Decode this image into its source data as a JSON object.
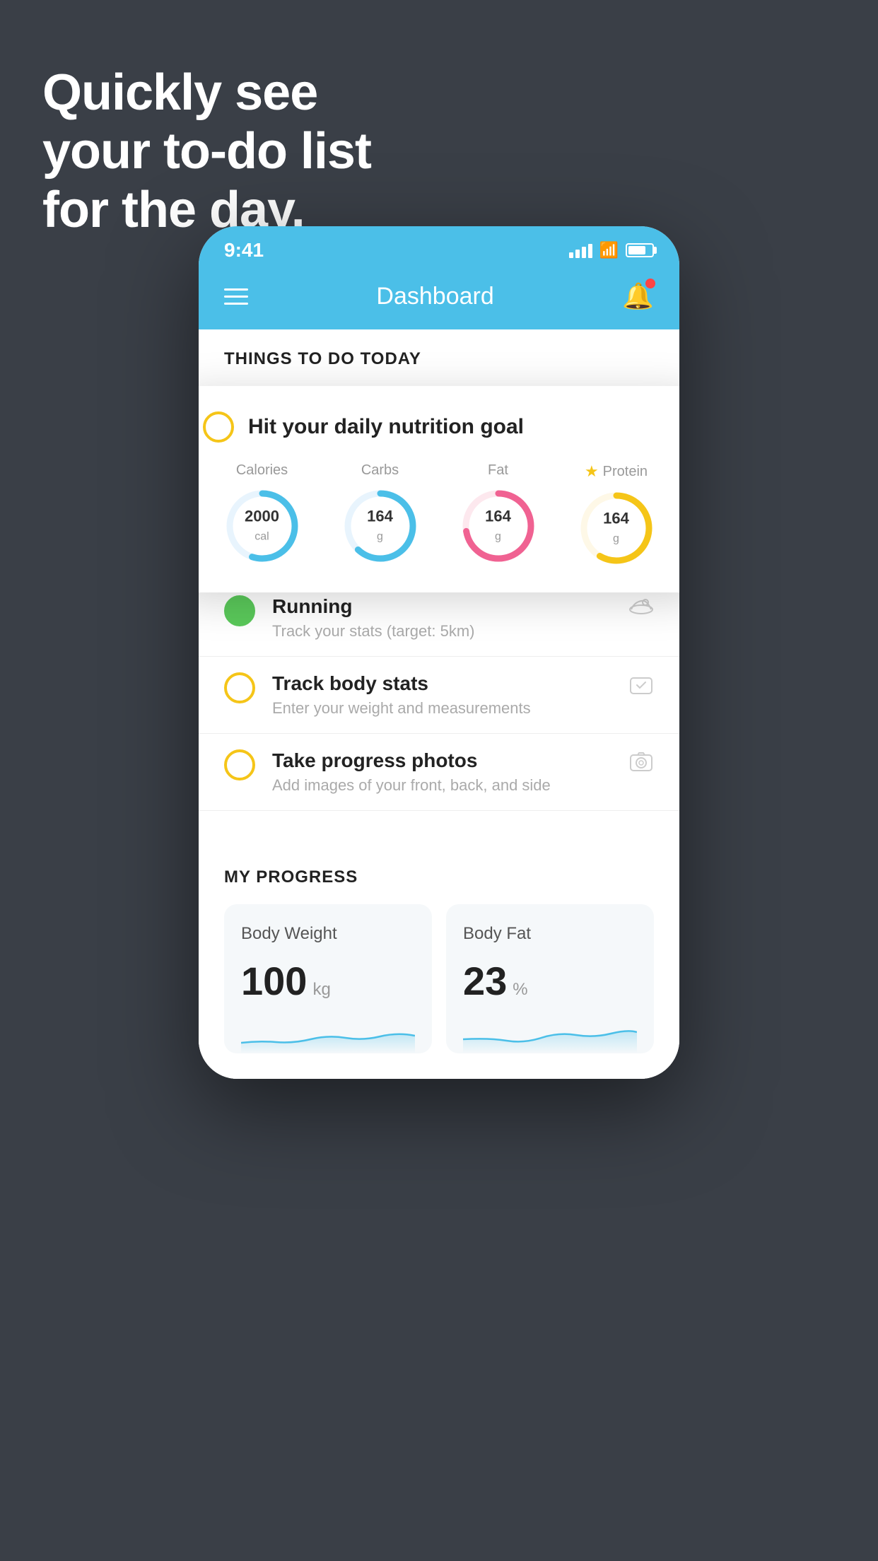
{
  "hero": {
    "title": "Quickly see\nyour to-do list\nfor the day."
  },
  "phone": {
    "status_bar": {
      "time": "9:41",
      "signal_bars": [
        8,
        12,
        16,
        20,
        22
      ],
      "wifi": "wifi",
      "battery": 75
    },
    "header": {
      "title": "Dashboard",
      "menu_label": "menu",
      "bell_label": "notifications",
      "has_notification": true
    },
    "todo_section": {
      "title": "THINGS TO DO TODAY"
    },
    "nutrition_card": {
      "checkbox_state": "incomplete",
      "title": "Hit your daily nutrition goal",
      "items": [
        {
          "label": "Calories",
          "value": "2000",
          "unit": "cal",
          "color": "#4bbfe8",
          "progress": 55,
          "starred": false
        },
        {
          "label": "Carbs",
          "value": "164",
          "unit": "g",
          "color": "#4bbfe8",
          "progress": 65,
          "starred": false
        },
        {
          "label": "Fat",
          "value": "164",
          "unit": "g",
          "color": "#f06292",
          "progress": 75,
          "starred": false
        },
        {
          "label": "Protein",
          "value": "164",
          "unit": "g",
          "color": "#f5c518",
          "progress": 60,
          "starred": true
        }
      ]
    },
    "todo_items": [
      {
        "id": "running",
        "title": "Running",
        "subtitle": "Track your stats (target: 5km)",
        "checkbox_color": "green",
        "checked": true,
        "icon": "shoe"
      },
      {
        "id": "track-body-stats",
        "title": "Track body stats",
        "subtitle": "Enter your weight and measurements",
        "checkbox_color": "yellow",
        "checked": false,
        "icon": "scale"
      },
      {
        "id": "progress-photos",
        "title": "Take progress photos",
        "subtitle": "Add images of your front, back, and side",
        "checkbox_color": "yellow",
        "checked": false,
        "icon": "photo"
      }
    ],
    "my_progress": {
      "title": "MY PROGRESS",
      "cards": [
        {
          "id": "body-weight",
          "title": "Body Weight",
          "value": "100",
          "unit": "kg"
        },
        {
          "id": "body-fat",
          "title": "Body Fat",
          "value": "23",
          "unit": "%"
        }
      ]
    }
  }
}
